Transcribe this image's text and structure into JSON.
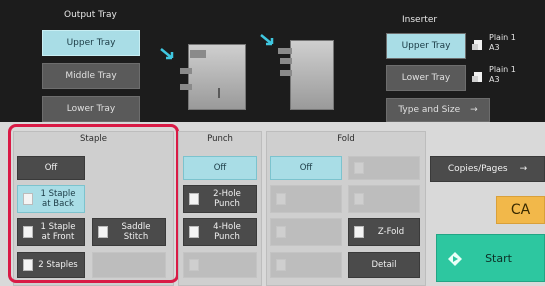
{
  "output_tray": {
    "title": "Output Tray",
    "upper": "Upper Tray",
    "middle": "Middle Tray",
    "lower": "Lower Tray"
  },
  "inserter": {
    "title": "Inserter",
    "upper": "Upper Tray",
    "lower": "Lower Tray",
    "upper_paper_type": "Plain 1",
    "upper_paper_size": "A3",
    "lower_paper_type": "Plain 1",
    "lower_paper_size": "A3",
    "type_size": "Type and Size",
    "type_size_arrow": "→"
  },
  "staple": {
    "title": "Staple",
    "off": "Off",
    "one_back_l1": "1 Staple",
    "one_back_l2": "at Back",
    "one_front_l1": "1 Staple",
    "one_front_l2": "at Front",
    "saddle_l1": "Saddle",
    "saddle_l2": "Stitch",
    "two": "2 Staples"
  },
  "punch": {
    "title": "Punch",
    "off": "Off",
    "two_l1": "2-Hole",
    "two_l2": "Punch",
    "four_l1": "4-Hole",
    "four_l2": "Punch"
  },
  "fold": {
    "title": "Fold",
    "off": "Off",
    "zfold": "Z-Fold",
    "detail": "Detail"
  },
  "right": {
    "copies_pages": "Copies/Pages",
    "copies_arrow": "→",
    "ca": "CA",
    "start": "Start"
  },
  "colors": {
    "accent_active": "#a9dde6",
    "start_green": "#2dc7a0",
    "ca_orange": "#f2b84a",
    "highlight_red": "#d91a45"
  }
}
